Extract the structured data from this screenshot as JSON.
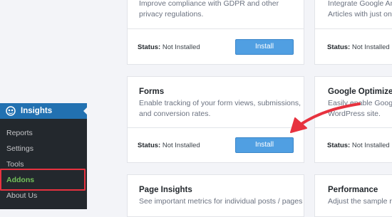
{
  "cards": {
    "top_left": {
      "desc_lines": [
        "Improve compliance with GDPR and other",
        "privacy regulations."
      ],
      "status_label": "Status:",
      "status_value": "Not Installed",
      "button": "Install"
    },
    "top_right": {
      "desc_lines": [
        "Integrate Google Ana",
        "Articles with just one"
      ],
      "status_label": "Status:",
      "status_value": "Not Installed"
    },
    "forms": {
      "title": "Forms",
      "desc_lines": [
        "Enable tracking of your form views, submissions,",
        "and conversion rates."
      ],
      "status_label": "Status:",
      "status_value": "Not Installed",
      "button": "Install"
    },
    "google_optimize": {
      "title": "Google Optimize",
      "desc_lines": [
        "Easily enable Google",
        "WordPress site."
      ],
      "status_label": "Status:",
      "status_value": "Not Installed"
    },
    "page_insights": {
      "title": "Page Insights",
      "desc_lines": [
        "See important metrics for individual posts / pages"
      ]
    },
    "performance": {
      "title": "Performance",
      "desc_lines": [
        "Adjust the sample rat"
      ]
    }
  },
  "sidebar": {
    "title": "Insights",
    "items": [
      {
        "label": "Reports"
      },
      {
        "label": "Settings"
      },
      {
        "label": "Tools"
      },
      {
        "label": "Addons"
      },
      {
        "label": "About Us"
      }
    ]
  },
  "colors": {
    "accent_button": "#509fe2",
    "sidebar_bg": "#23282d",
    "sidebar_header": "#2271b1",
    "active_item": "#72c159",
    "annotation_red": "#e7323f"
  }
}
